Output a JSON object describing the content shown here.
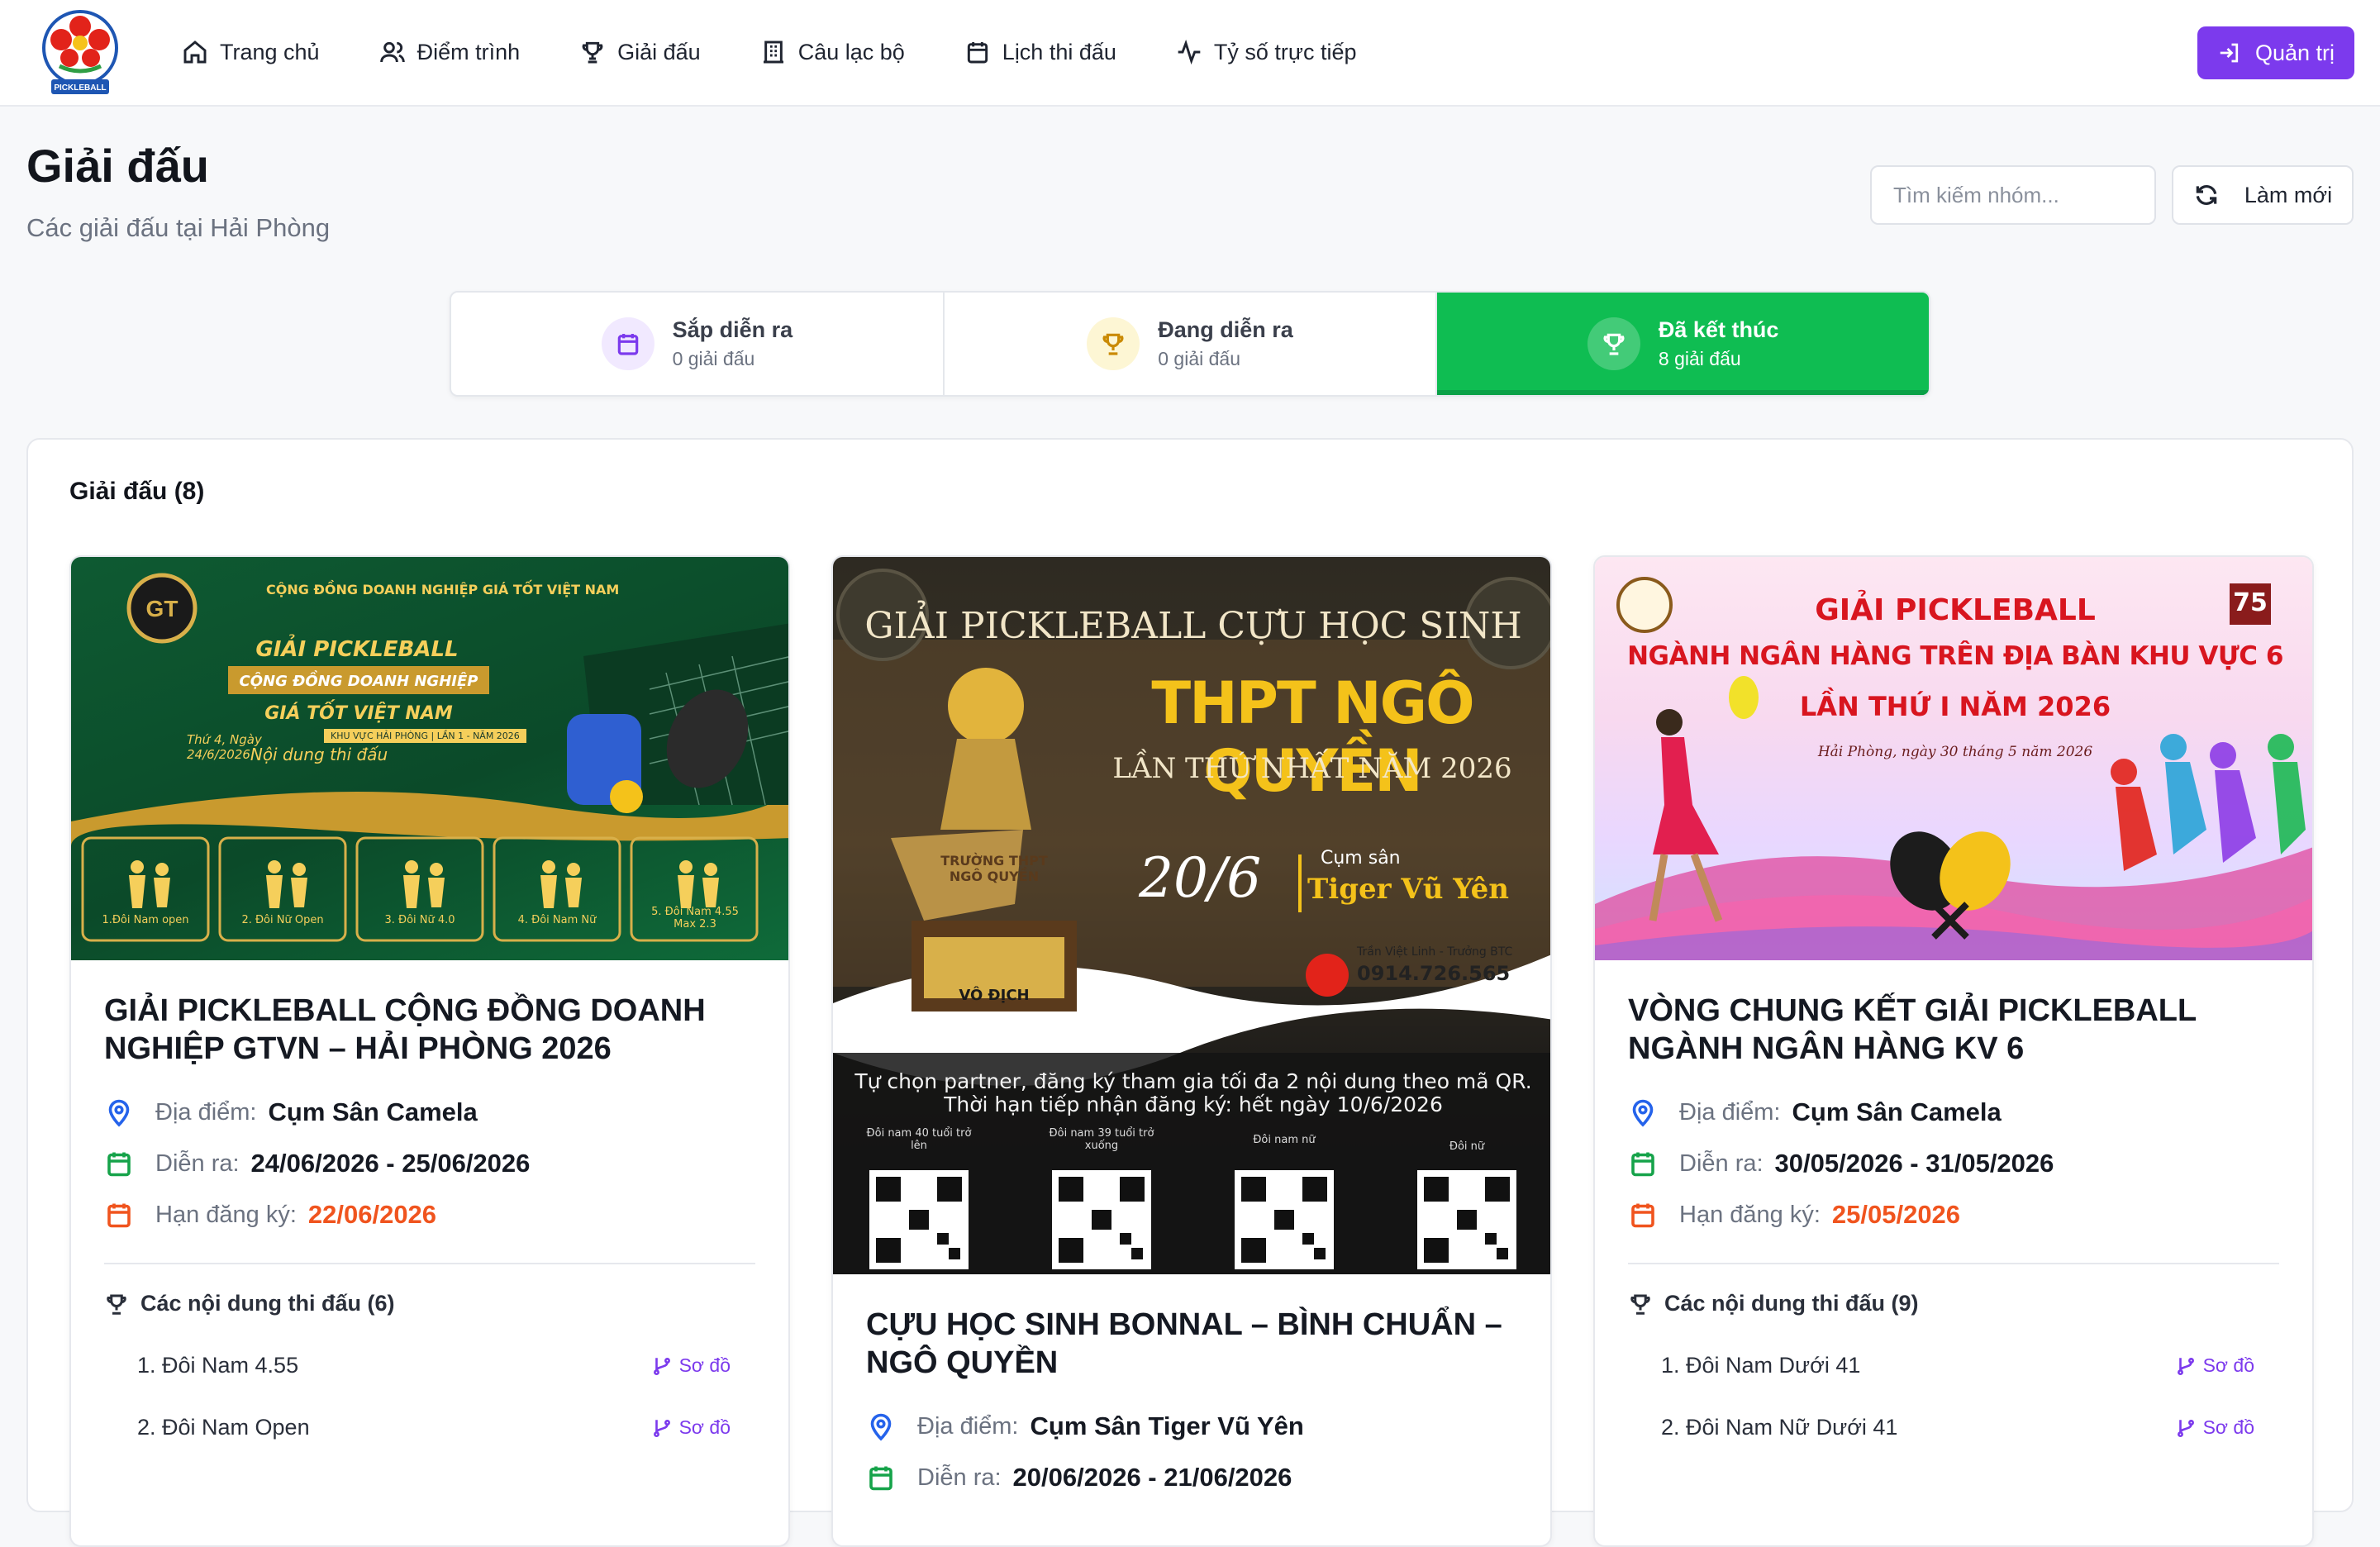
{
  "nav": {
    "items": [
      {
        "label": "Trang chủ",
        "icon": "home-icon"
      },
      {
        "label": "Điểm trình",
        "icon": "users-icon"
      },
      {
        "label": "Giải đấu",
        "icon": "trophy-icon"
      },
      {
        "label": "Câu lạc bộ",
        "icon": "building-icon"
      },
      {
        "label": "Lịch thi đấu",
        "icon": "calendar-icon"
      },
      {
        "label": "Tỷ số trực tiếp",
        "icon": "activity-icon"
      }
    ],
    "admin_label": "Quản trị",
    "logo_text": "HẢI PHÒNG PICKLEBALL"
  },
  "header": {
    "title": "Giải đấu",
    "subtitle": "Các giải đấu tại Hải Phòng",
    "search_placeholder": "Tìm kiếm nhóm...",
    "refresh_label": "Làm mới"
  },
  "tabs": [
    {
      "label": "Sắp diễn ra",
      "count": "0 giải đấu",
      "icon": "calendar-icon",
      "active": false
    },
    {
      "label": "Đang diễn ra",
      "count": "0 giải đấu",
      "icon": "trophy-icon",
      "active": false
    },
    {
      "label": "Đã kết thúc",
      "count": "8 giải đấu",
      "icon": "trophy-icon",
      "active": true
    }
  ],
  "list": {
    "title": "Giải đấu (8)",
    "cards": [
      {
        "title": "GIẢI PICKLEBALL CỘNG ĐỒNG DOANH NGHIỆP GTVN – HẢI PHÒNG 2026",
        "location_label": "Địa điểm:",
        "location": "Cụm Sân Camela",
        "date_label": "Diễn ra:",
        "date": "24/06/2026 - 25/06/2026",
        "deadline_label": "Hạn đăng ký:",
        "deadline": "22/06/2026",
        "events_title": "Các nội dung thi đấu (6)",
        "events": [
          "1. Đôi Nam 4.55",
          "2. Đôi Nam Open"
        ],
        "link_label": "Sơ đồ",
        "banner": {
          "top": "CỘNG ĐỒNG DOANH NGHIỆP GIÁ TỐT VIỆT NAM",
          "l1": "GIẢI PICKLEBALL",
          "l2": "CỘNG ĐỒNG DOANH NGHIỆP",
          "l3": "GIÁ TỐT VIỆT NAM",
          "l4": "KHU VỰC HẢI PHÒNG | LẦN 1 - NĂM 2026",
          "date": "Thứ 4, Ngày 24/6/2026",
          "content": "Nội dung thi đấu",
          "tiles": [
            "1.Đôi Nam open",
            "2. Đôi Nữ Open",
            "3. Đôi Nữ 4.0",
            "4. Đôi Nam Nữ",
            "5. Đôi Nam 4.55 Max 2.3"
          ]
        }
      },
      {
        "title": "CỰU HỌC SINH BONNAL – BÌNH CHUẨN – NGÔ QUYỀN",
        "location_label": "Địa điểm:",
        "location": "Cụm Sân Tiger Vũ Yên",
        "date_label": "Diễn ra:",
        "date": "20/06/2026 - 21/06/2026",
        "banner": {
          "l1": "GIẢI PICKLEBALL CỰU HỌC SINH",
          "l2": "THPT NGÔ QUYỀN",
          "l3": "LẦN THỨ NHẤT NĂM 2026",
          "date": "20/6",
          "venue_small": "Cụm sân",
          "venue": "Tiger Vũ Yên",
          "contact": "Trần Việt Linh - Trưởng BTC",
          "phone": "0914.726.565",
          "trophy1": "TRƯỜNG THPT NGÔ QUYỀN",
          "trophy2": "VÔ ĐỊCH",
          "note1": "Tự chọn partner, đăng ký tham gia tối đa 2 nội dung theo mã QR.",
          "note2": "Thời hạn tiếp nhận đăng ký: hết ngày 10/6/2026",
          "qr": [
            "Đôi nam 40 tuổi trở lên",
            "Đôi nam 39 tuổi trở xuống",
            "Đôi nam nữ",
            "Đôi nữ"
          ]
        }
      },
      {
        "title": "VÒNG CHUNG KẾT GIẢI PICKLEBALL NGÀNH NGÂN HÀNG KV 6",
        "location_label": "Địa điểm:",
        "location": "Cụm Sân Camela",
        "date_label": "Diễn ra:",
        "date": "30/05/2026 - 31/05/2026",
        "deadline_label": "Hạn đăng ký:",
        "deadline": "25/05/2026",
        "events_title": "Các nội dung thi đấu (9)",
        "events": [
          "1. Đôi Nam Dưới 41",
          "2. Đôi Nam Nữ Dưới 41"
        ],
        "link_label": "Sơ đồ",
        "banner": {
          "l1": "GIẢI PICKLEBALL",
          "l2": "NGÀNH NGÂN HÀNG TRÊN ĐỊA BÀN KHU VỰC 6",
          "l3": "LẦN THỨ I NĂM 2026",
          "l4": "Hải Phòng, ngày 30 tháng 5 năm 2026",
          "badge": "75"
        }
      }
    ]
  },
  "colors": {
    "accent": "#7c3aed",
    "active_tab": "#0fbd52",
    "deadline": "#f0541e",
    "date_icon": "#16a34a",
    "location_icon": "#2563eb"
  }
}
